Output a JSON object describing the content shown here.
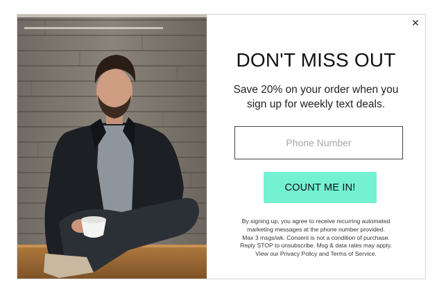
{
  "popup": {
    "close_label": "×",
    "headline": "DON'T MISS OUT",
    "subheadline": "Save 20% on your order when you sign up for weekly text deals.",
    "phone_placeholder": "Phone Number",
    "phone_value": "",
    "cta_label": "COUNT ME IN!",
    "disclaimer_lines": [
      "By signing up, you agree to receive recurring automated",
      "marketing messages at the phone number provided.",
      "Max 3 msgs/wk. Consent is not a condition of purchase.",
      "Reply STOP to unsubscribe. Msg & data rates may apply.",
      "View our Privacy Policy and Terms of Service."
    ]
  },
  "colors": {
    "cta_background": "#74f0d3",
    "input_border": "#444444",
    "text": "#111111"
  },
  "icons": {
    "close": "close-icon"
  }
}
